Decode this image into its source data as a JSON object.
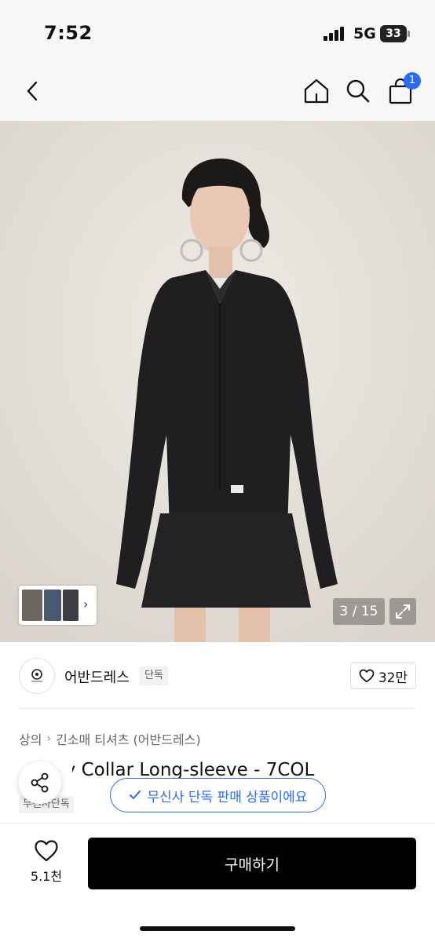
{
  "status_bar": {
    "time": "7:52",
    "network": "5G",
    "battery": "33"
  },
  "nav": {
    "cart_count": "1",
    "icons": [
      "back-chevron-icon",
      "home-icon",
      "search-icon",
      "shopping-bag-icon"
    ]
  },
  "gallery": {
    "counter": "3 / 15",
    "current_image": 3,
    "total_images": 15
  },
  "brand": {
    "name": "어반드레스",
    "tag": "단독",
    "likes": "32만"
  },
  "product": {
    "breadcrumb": [
      "상의",
      "긴소매 티셔츠 (어반드레스)"
    ],
    "title": "Satiny Collar Long-sleeve - 7COL",
    "tag": "무신사단독",
    "exclusive_notice": "무신사 단독 판매 상품이에요"
  },
  "bottom_bar": {
    "wishlist_count": "5.1천",
    "buy_label": "구매하기"
  },
  "colors": {
    "accent_blue": "#2b6bf3",
    "buy_button": "#000000"
  }
}
